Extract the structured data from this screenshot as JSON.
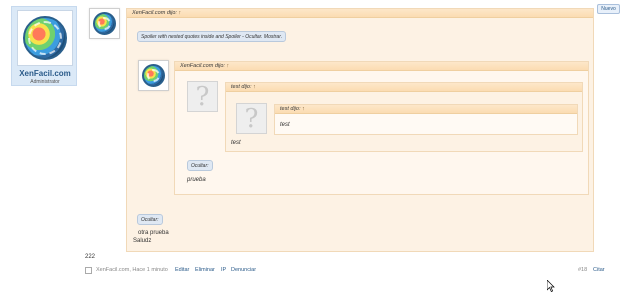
{
  "user": {
    "name": "XenFacil.com",
    "role": "Administrator"
  },
  "toolbar": {
    "nuevo_label": "Nuevo"
  },
  "outer_quote": {
    "author": "XenFacil.com dijo:",
    "arrow": "↑",
    "spoiler_label": "Spoiler with nested quotes inside and Spoiler - Ocultar. Mostrar."
  },
  "inner_quote": {
    "author": "XenFacil.com dijo:",
    "arrow": "↑"
  },
  "test_quote_1": {
    "author": "test dijo:",
    "arrow": "↑",
    "trailing_text": "test"
  },
  "test_quote_2": {
    "author": "test dijo:",
    "arrow": "↑",
    "text": "test"
  },
  "hidden_spoiler_1": {
    "label": "Ocultar:",
    "text": "prueba"
  },
  "hidden_spoiler_2": {
    "label": "Ocultar:",
    "text": "otra prueba"
  },
  "post": {
    "saludo": "Saludz",
    "number": "222"
  },
  "footer": {
    "meta": "XenFacil.com, Hace 1 minuto",
    "edit": "Editar",
    "delete": "Eliminar",
    "ip": "IP",
    "report": "Denunciar",
    "post_number": "#18",
    "quote": "Citar"
  }
}
